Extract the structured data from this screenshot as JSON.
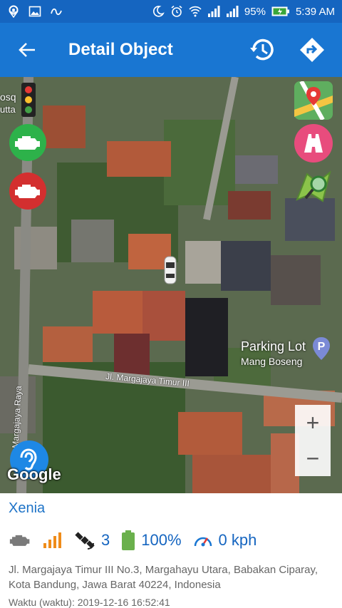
{
  "status_bar": {
    "battery": "95%",
    "time": "5:39 AM",
    "left_icons": [
      "location-icon",
      "image-icon",
      "swipe-icon"
    ],
    "right_icons": [
      "do-not-disturb-icon",
      "alarm-icon",
      "wifi-icon",
      "signal-icon",
      "battery-icon"
    ]
  },
  "app_bar": {
    "title": "Detail Object",
    "actions": [
      "history-icon",
      "directions-icon"
    ]
  },
  "map": {
    "place_name": "Parking Lot",
    "place_sub": "Mang Boseng",
    "street_main": "Jl. Margajaya Timur III",
    "street_side": "Margajaya Raya",
    "street_top_fragment1": "osq",
    "street_top_fragment2": "utta",
    "google_label": "Google",
    "zoom_in": "+",
    "zoom_out": "−",
    "controls": [
      "traffic-light-icon",
      "engine-on-icon",
      "engine-off-icon",
      "map-type-icon",
      "road-icon",
      "layers-icon",
      "listen-icon"
    ]
  },
  "vehicle": {
    "name": "Xenia",
    "satellites": "3",
    "battery": "100%",
    "speed": "0 kph",
    "address": "Jl. Margajaya Timur III No.3, Margahayu Utara, Babakan Ciparay, Kota Bandung, Jawa Barat 40224, Indonesia",
    "time_partial": "Waktu (waktu): 2019-12-16 16:52:41",
    "colors": {
      "accent": "#1976d2",
      "signal": "#ef8c1a",
      "battery": "#6ab04c"
    }
  }
}
